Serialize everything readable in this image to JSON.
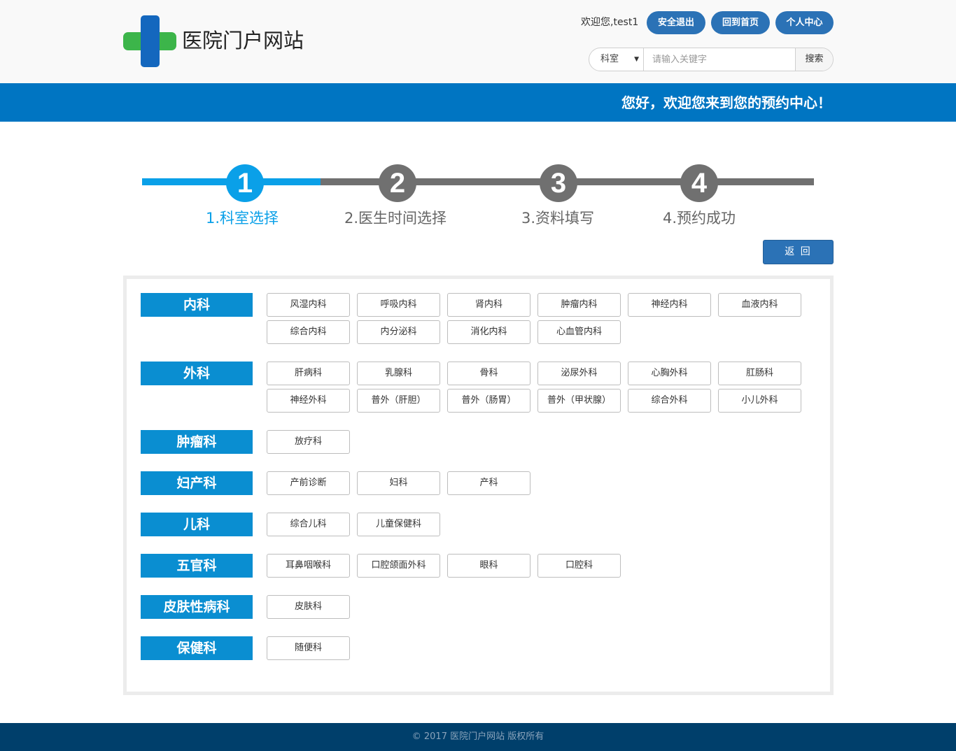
{
  "header": {
    "site_title": "医院门户网站",
    "welcome": "欢迎您,test1",
    "logout_label": "安全退出",
    "home_label": "回到首页",
    "profile_label": "个人中心",
    "search": {
      "category": "科室",
      "placeholder": "请输入关键字",
      "button_label": "搜索"
    },
    "colors": {
      "logo_green": "#3cb54a",
      "logo_blue": "#1467be",
      "pill": "#2b72b6"
    }
  },
  "banner": {
    "text": "您好，欢迎您来到您的预约中心！",
    "color": "#0075c2"
  },
  "steps": {
    "numbers": [
      "1",
      "2",
      "3",
      "4"
    ],
    "labels": [
      "1.科室选择",
      "2.医生时间选择",
      "3.资料填写",
      "4.预约成功"
    ],
    "active_step": 1,
    "active_color": "#0aa0e8",
    "inactive_color": "#707070"
  },
  "back_label": "返 回",
  "categories": [
    {
      "name": "内科",
      "departments": [
        "风湿内科",
        "呼吸内科",
        "肾内科",
        "肿瘤内科",
        "神经内科",
        "血液内科",
        "综合内科",
        "内分泌科",
        "消化内科",
        "心血管内科"
      ]
    },
    {
      "name": "外科",
      "departments": [
        "肝病科",
        "乳腺科",
        "骨科",
        "泌尿外科",
        "心胸外科",
        "肛肠科",
        "神经外科",
        "普外（肝胆）",
        "普外（肠胃）",
        "普外（甲状腺）",
        "综合外科",
        "小儿外科"
      ]
    },
    {
      "name": "肿瘤科",
      "departments": [
        "放疗科"
      ]
    },
    {
      "name": "妇产科",
      "departments": [
        "产前诊断",
        "妇科",
        "产科"
      ]
    },
    {
      "name": "儿科",
      "departments": [
        "综合儿科",
        "儿童保健科"
      ]
    },
    {
      "name": "五官科",
      "departments": [
        "耳鼻咽喉科",
        "口腔颌面外科",
        "眼科",
        "口腔科"
      ]
    },
    {
      "name": "皮肤性病科",
      "departments": [
        "皮肤科"
      ]
    },
    {
      "name": "保健科",
      "departments": [
        "随便科"
      ]
    }
  ],
  "footer": {
    "text": "© 2017 医院门户网站 版权所有"
  }
}
